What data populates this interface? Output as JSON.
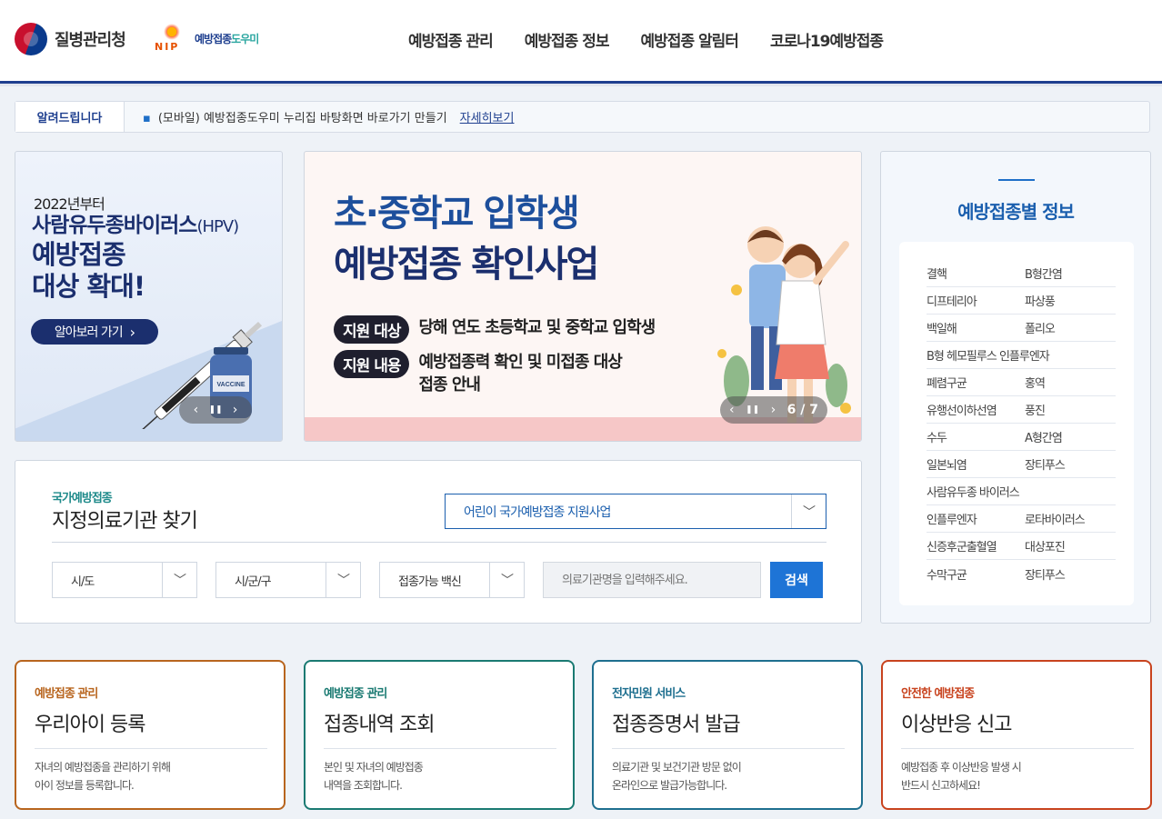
{
  "header": {
    "agency_name": "질병관리청",
    "brand_logo": "NIP",
    "brand_name_a": "예방접종",
    "brand_name_b": "도우미",
    "nav": [
      "예방접종 관리",
      "예방접종 정보",
      "예방접종 알림터",
      "코로나19예방접종"
    ]
  },
  "notice": {
    "label": "알려드립니다",
    "text": "(모바일) 예방접종도우미 누리집 바탕화면 바로가기 만들기",
    "more": "자세히보기"
  },
  "banner_hpv": {
    "sub": "2022년부터",
    "title_main": "사람유두종바이러스",
    "title_paren": "(HPV)",
    "big_line1": "예방접종",
    "big_line2": "대상 확대!",
    "button": "알아보러 가기",
    "vial_label": "VACCINE"
  },
  "banner_school": {
    "title1": "초·중학교 입학생",
    "title2": "예방접종 확인사업",
    "row1_label": "지원 대상",
    "row1_text": "당해 연도 초등학교 및 중학교 입학생",
    "row2_label": "지원 내용",
    "row2_text_line1": "예방접종력 확인 및 미접종 대상",
    "row2_text_line2": "접종 안내",
    "counter": "6 / 7"
  },
  "carousel_icons": {
    "prev": "‹",
    "pause": "❚❚",
    "next": "›"
  },
  "vaccine_info": {
    "title": "예방접종별 정보",
    "rows": [
      [
        "결핵",
        "B형간염"
      ],
      [
        "디프테리아",
        "파상풍"
      ],
      [
        "백일해",
        "폴리오"
      ],
      [
        "B형 헤모필루스 인플루엔자",
        ""
      ],
      [
        "폐렴구균",
        "홍역"
      ],
      [
        "유행선이하선염",
        "풍진"
      ],
      [
        "수두",
        "A형간염"
      ],
      [
        "일본뇌염",
        "장티푸스"
      ],
      [
        "사람유두종 바이러스",
        ""
      ],
      [
        "인플루엔자",
        "로타바이러스"
      ],
      [
        "신증후군출혈열",
        "대상포진"
      ],
      [
        "수막구균",
        "장티푸스"
      ]
    ]
  },
  "search": {
    "sub": "국가예방접종",
    "title": "지정의료기관 찾기",
    "program": "어린이 국가예방접종 지원사업",
    "select_city": "시/도",
    "select_district": "시/군/구",
    "select_vaccine": "접종가능 백신",
    "placeholder": "의료기관명을 입력해주세요.",
    "button": "검색"
  },
  "quick_cards": [
    {
      "sub": "예방접종 관리",
      "title": "우리아이 등록",
      "desc1": "자녀의 예방접종을 관리하기 위해",
      "desc2": "아이 정보를 등록합니다.",
      "color": "#b8651e"
    },
    {
      "sub": "예방접종 관리",
      "title": "접종내역 조회",
      "desc1": "본인 및 자녀의 예방접종",
      "desc2": "내역을 조회합니다.",
      "color": "#1a7a72"
    },
    {
      "sub": "전자민원 서비스",
      "title": "접종증명서 발급",
      "desc1": "의료기관 및 보건기관 방문 없이",
      "desc2": "온라인으로 발급가능합니다.",
      "color": "#1e6f8f"
    },
    {
      "sub": "안전한 예방접종",
      "title": "이상반응 신고",
      "desc1": "예방접종 후 이상반응 발생 시",
      "desc2": "반드시 신고하세요!",
      "color": "#c8431e"
    }
  ]
}
